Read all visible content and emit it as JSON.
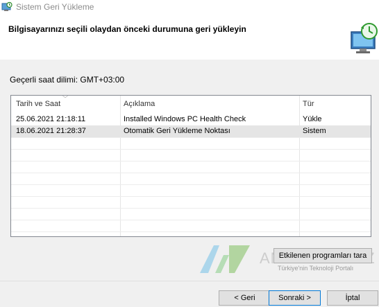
{
  "window": {
    "title": "Sistem Geri Yükleme"
  },
  "header": {
    "title": "Bilgisayarınızı seçili olaydan önceki durumuna geri yükleyin"
  },
  "timezone": {
    "label": "Geçerli saat dilimi: GMT+03:00"
  },
  "table": {
    "columns": [
      "Tarih ve Saat",
      "Açıklama",
      "Tür"
    ],
    "rows": [
      {
        "date": "25.06.2021 21:18:11",
        "description": "Installed Windows PC Health Check",
        "type": "Yükle"
      },
      {
        "date": "18.06.2021 21:28:37",
        "description": "Otomatik Geri Yükleme Noktası",
        "type": "Sistem"
      }
    ]
  },
  "buttons": {
    "scan": "Etkilenen programları tara",
    "back": "< Geri",
    "next": "Sonraki >",
    "cancel": "İptal"
  },
  "watermark": {
    "brand": "ANDROIDAYAZ",
    "tagline": "Türkiye'nin Teknoloji Portalı"
  }
}
